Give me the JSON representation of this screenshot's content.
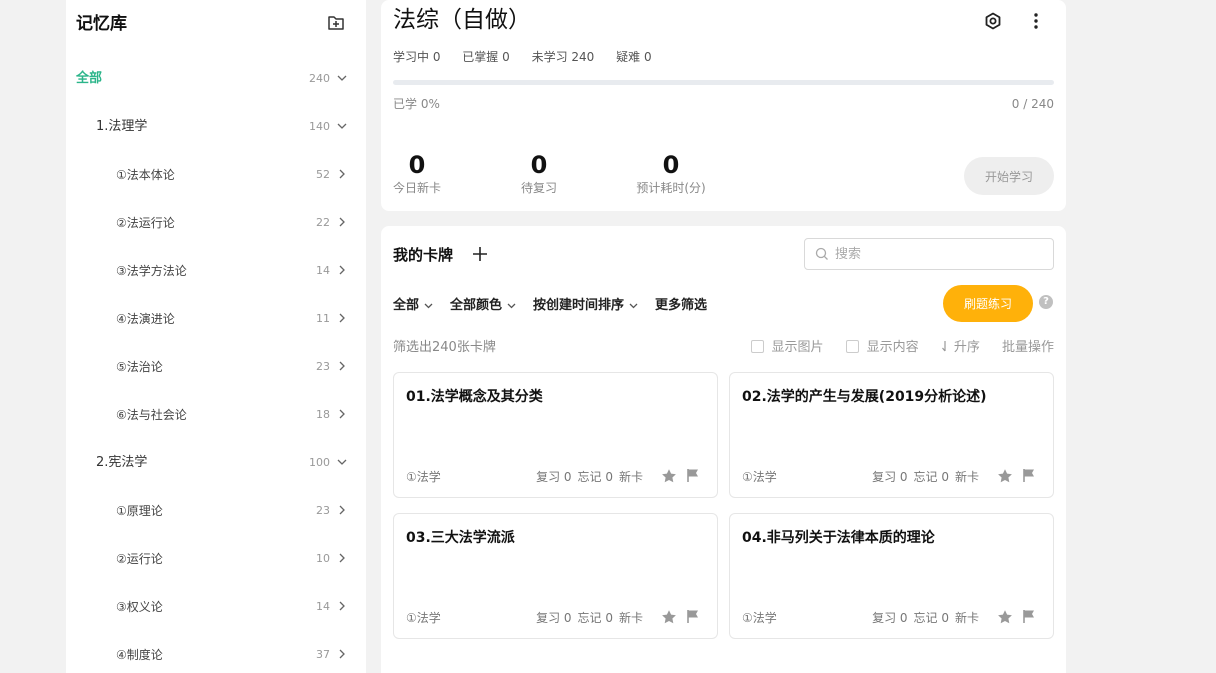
{
  "sidebar": {
    "title": "记忆库",
    "items": [
      {
        "label": "全部",
        "count": "240",
        "level": 0,
        "expanded": true
      },
      {
        "label": "1.法理学",
        "count": "140",
        "level": 1,
        "expanded": true
      },
      {
        "label": "①法本体论",
        "count": "52",
        "level": 2,
        "expanded": false
      },
      {
        "label": "②法运行论",
        "count": "22",
        "level": 2,
        "expanded": false
      },
      {
        "label": "③法学方法论",
        "count": "14",
        "level": 2,
        "expanded": false
      },
      {
        "label": "④法演进论",
        "count": "11",
        "level": 2,
        "expanded": false
      },
      {
        "label": "⑤法治论",
        "count": "23",
        "level": 2,
        "expanded": false
      },
      {
        "label": "⑥法与社会论",
        "count": "18",
        "level": 2,
        "expanded": false
      },
      {
        "label": "2.宪法学",
        "count": "100",
        "level": 1,
        "expanded": true
      },
      {
        "label": "①原理论",
        "count": "23",
        "level": 2,
        "expanded": false
      },
      {
        "label": "②运行论",
        "count": "10",
        "level": 2,
        "expanded": false
      },
      {
        "label": "③权义论",
        "count": "14",
        "level": 2,
        "expanded": false
      },
      {
        "label": "④制度论",
        "count": "37",
        "level": 2,
        "expanded": false
      }
    ]
  },
  "deck": {
    "title": "法综（自做）",
    "stats": {
      "learning": "学习中 0",
      "mastered": "已掌握 0",
      "unlearned": "未学习 240",
      "difficult": "疑难 0"
    },
    "progress_fraction": 0,
    "learned_label": "已学 0%",
    "ratio": "0 / 240",
    "today_new": {
      "value": "0",
      "label": "今日新卡"
    },
    "to_review": {
      "value": "0",
      "label": "待复习"
    },
    "est_time": {
      "value": "0",
      "label": "预计耗时(分)"
    },
    "start_label": "开始学习"
  },
  "cards_panel": {
    "title": "我的卡牌",
    "search_placeholder": "搜索",
    "filters": [
      "全部",
      "全部颜色",
      "按创建时间排序"
    ],
    "more_filters": "更多筛选",
    "practice_label": "刷题练习",
    "filtered_text": "筛选出240张卡牌",
    "show_images": "显示图片",
    "show_content": "显示内容",
    "sort_asc": "升序",
    "batch": "批量操作",
    "cards": [
      {
        "title": "01.法学概念及其分类",
        "tag": "①法学",
        "review": "复习 0",
        "forget": "忘记 0",
        "status": "新卡"
      },
      {
        "title": "02.法学的产生与发展(2019分析论述)",
        "tag": "①法学",
        "review": "复习 0",
        "forget": "忘记 0",
        "status": "新卡"
      },
      {
        "title": "03.三大法学流派",
        "tag": "①法学",
        "review": "复习 0",
        "forget": "忘记 0",
        "status": "新卡"
      },
      {
        "title": "04.非马列关于法律本质的理论",
        "tag": "①法学",
        "review": "复习 0",
        "forget": "忘记 0",
        "status": "新卡"
      }
    ]
  },
  "colors": {
    "accent_green": "#2bb58a",
    "practice_orange": "#ffb10a"
  }
}
